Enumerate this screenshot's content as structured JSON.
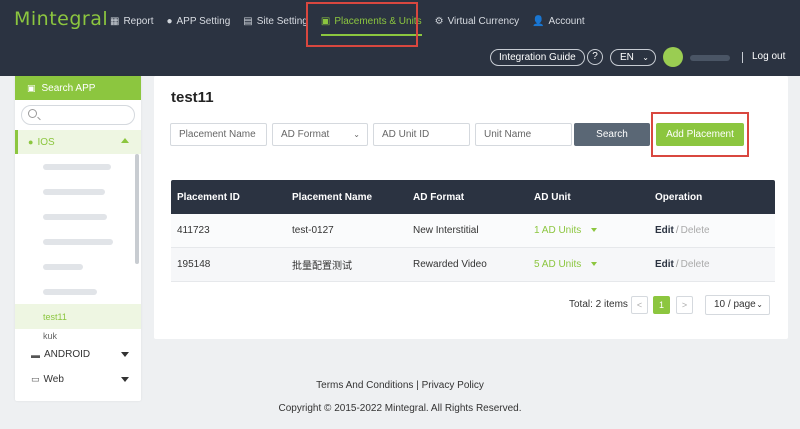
{
  "header": {
    "logo": "Mintegral",
    "nav": [
      {
        "label": "Report",
        "icon": "grid-icon"
      },
      {
        "label": "APP Setting",
        "icon": "android-icon"
      },
      {
        "label": "Site Setting",
        "icon": "list-icon"
      },
      {
        "label": "Placements & Units",
        "icon": "folder-icon"
      },
      {
        "label": "Virtual Currency",
        "icon": "gear-icon"
      },
      {
        "label": "Account",
        "icon": "user-icon"
      }
    ],
    "integration_guide": "Integration Guide",
    "help": "?",
    "language": "EN",
    "logout": "Log out"
  },
  "sidebar": {
    "search_title": "Search APP",
    "categories": {
      "ios": "IOS",
      "android": "ANDROID",
      "web": "Web"
    },
    "active_app": "test11",
    "partial_app": "kuk"
  },
  "main": {
    "title": "test11",
    "filters": {
      "placement_name": "Placement Name",
      "ad_format": "AD Format",
      "ad_unit_id": "AD Unit ID",
      "unit_name": "Unit Name"
    },
    "search_button": "Search",
    "add_button": "Add Placement",
    "table": {
      "columns": [
        "Placement ID",
        "Placement Name",
        "AD Format",
        "AD Unit",
        "Operation"
      ],
      "rows": [
        {
          "id": "411723",
          "name": "test-0127",
          "format": "New Interstitial",
          "units": "1 AD Units",
          "edit": "Edit",
          "sep": "/",
          "delete": "Delete"
        },
        {
          "id": "195148",
          "name": "批量配置测试",
          "format": "Rewarded Video",
          "units": "5 AD Units",
          "edit": "Edit",
          "sep": "/",
          "delete": "Delete"
        }
      ]
    },
    "pagination": {
      "total": "Total: 2 items",
      "prev": "<",
      "current": "1",
      "next": ">",
      "page_size": "10 / page"
    }
  },
  "footer": {
    "links": "Terms And Conditions | Privacy Policy",
    "copyright": "Copyright © 2015-2022 Mintegral. All Rights Reserved."
  },
  "colors": {
    "brand_green": "#8cc63f",
    "header_dark": "#2b3341",
    "highlight_red": "#d9473f"
  }
}
